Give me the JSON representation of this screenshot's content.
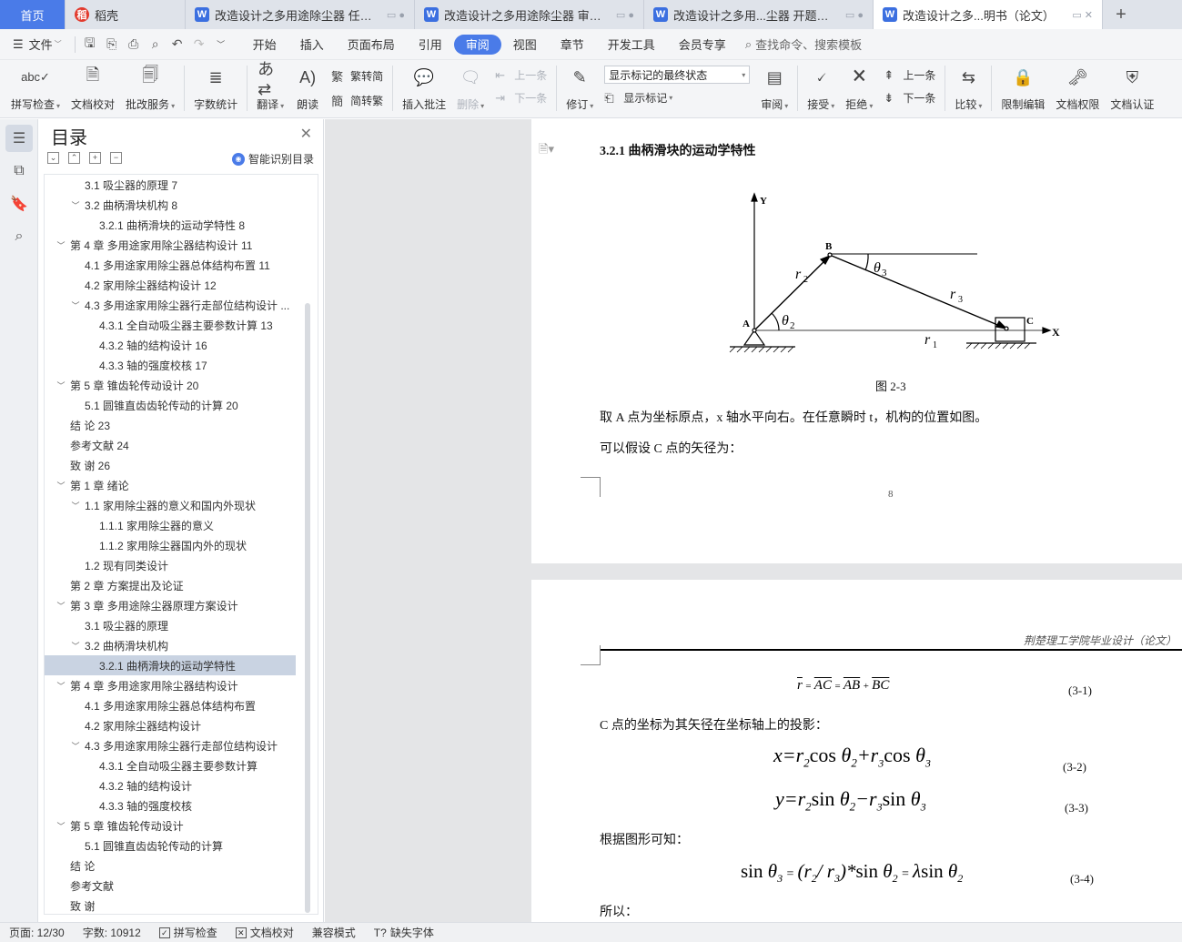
{
  "tabs": [
    {
      "label": "首页",
      "kind": "home"
    },
    {
      "label": "稻壳",
      "kind": "docer"
    },
    {
      "label": "改造设计之多用途除尘器 任务书",
      "kind": "doc"
    },
    {
      "label": "改造设计之多用途除尘器 审批表",
      "kind": "doc"
    },
    {
      "label": "改造设计之多用...尘器 开题报告",
      "kind": "doc"
    },
    {
      "label": "改造设计之多...明书（论文）",
      "kind": "doc",
      "active": true
    }
  ],
  "menubar": {
    "file_label": "文件",
    "tabs": [
      "开始",
      "插入",
      "页面布局",
      "引用",
      "审阅",
      "视图",
      "章节",
      "开发工具",
      "会员专享"
    ],
    "active_tab": "审阅",
    "search_placeholder": "查找命令、搜索模板"
  },
  "ribbon": {
    "spell_check": "拼写检查",
    "doc_proof": "文档校对",
    "review_service": "批改服务",
    "word_count": "字数统计",
    "translate": "翻译",
    "read_aloud": "朗读",
    "trad_to_simp": "繁转简",
    "simp_to_trad": "简转繁",
    "insert_comment": "插入批注",
    "delete": "删除",
    "prev_comment": "上一条",
    "next_comment": "下一条",
    "track_changes": "修订",
    "markup_state": "显示标记的最终状态",
    "show_markup": "显示标记",
    "review": "审阅",
    "accept": "接受",
    "reject": "拒绝",
    "prev_change": "上一条",
    "next_change": "下一条",
    "compare": "比较",
    "restrict_edit": "限制编辑",
    "doc_permission": "文档权限",
    "doc_cert": "文档认证"
  },
  "toc": {
    "title": "目录",
    "smart_label": "智能识别目录",
    "items": [
      {
        "text": "3.1 吸尘器的原理 7",
        "level": 2,
        "chevron": false
      },
      {
        "text": "3.2  曲柄滑块机构 8",
        "level": 2,
        "chevron": true
      },
      {
        "text": "3.2.1 曲柄滑块的运动学特性 8",
        "level": 3,
        "chevron": false
      },
      {
        "text": "第 4 章  多用途家用除尘器结构设计 11",
        "level": 1,
        "chevron": true
      },
      {
        "text": "4.1  多用途家用除尘器总体结构布置 11",
        "level": 2,
        "chevron": false
      },
      {
        "text": "4.2 家用除尘器结构设计 12",
        "level": 2,
        "chevron": false
      },
      {
        "text": "4.3 多用途家用除尘器行走部位结构设计  ...",
        "level": 2,
        "chevron": true
      },
      {
        "text": "4.3.1 全自动吸尘器主要参数计算 13",
        "level": 3,
        "chevron": false
      },
      {
        "text": "4.3.2 轴的结构设计 16",
        "level": 3,
        "chevron": false
      },
      {
        "text": "4.3.3 轴的强度校核 17",
        "level": 3,
        "chevron": false
      },
      {
        "text": "第 5 章  锥齿轮传动设计 20",
        "level": 1,
        "chevron": true
      },
      {
        "text": "5.1 圆锥直齿齿轮传动的计算 20",
        "level": 2,
        "chevron": false
      },
      {
        "text": "结    论 23",
        "level": 1,
        "chevron": false
      },
      {
        "text": "参考文献 24",
        "level": 1,
        "chevron": false
      },
      {
        "text": "致    谢 26",
        "level": 1,
        "chevron": false
      },
      {
        "text": "第 1 章  绪论",
        "level": 1,
        "chevron": true
      },
      {
        "text": "1.1 家用除尘器的意义和国内外现状",
        "level": 2,
        "chevron": true
      },
      {
        "text": "1.1.1 家用除尘器的意义",
        "level": 3,
        "chevron": false
      },
      {
        "text": "1.1.2 家用除尘器国内外的现状",
        "level": 3,
        "chevron": false
      },
      {
        "text": "1.2 现有同类设计",
        "level": 2,
        "chevron": false
      },
      {
        "text": "第 2 章  方案提出及论证",
        "level": 1,
        "chevron": false
      },
      {
        "text": "第 3 章  多用途除尘器原理方案设计",
        "level": 1,
        "chevron": true
      },
      {
        "text": "3.1 吸尘器的原理",
        "level": 2,
        "chevron": false
      },
      {
        "text": "3.2  曲柄滑块机构",
        "level": 2,
        "chevron": true
      },
      {
        "text": "3.2.1 曲柄滑块的运动学特性",
        "level": 3,
        "chevron": false,
        "selected": true
      },
      {
        "text": "第 4 章  多用途家用除尘器结构设计",
        "level": 1,
        "chevron": true
      },
      {
        "text": "4.1  多用途家用除尘器总体结构布置",
        "level": 2,
        "chevron": false
      },
      {
        "text": "4.2 家用除尘器结构设计",
        "level": 2,
        "chevron": false
      },
      {
        "text": "4.3 多用途家用除尘器行走部位结构设计",
        "level": 2,
        "chevron": true
      },
      {
        "text": "4.3.1 全自动吸尘器主要参数计算",
        "level": 3,
        "chevron": false
      },
      {
        "text": "4.3.2 轴的结构设计",
        "level": 3,
        "chevron": false
      },
      {
        "text": "4.3.3 轴的强度校核",
        "level": 3,
        "chevron": false
      },
      {
        "text": "第 5 章  锥齿轮传动设计",
        "level": 1,
        "chevron": true
      },
      {
        "text": "5.1 圆锥直齿齿轮传动的计算",
        "level": 2,
        "chevron": false
      },
      {
        "text": "结    论",
        "level": 1,
        "chevron": false
      },
      {
        "text": "参考文献",
        "level": 1,
        "chevron": false
      },
      {
        "text": "致    谢",
        "level": 1,
        "chevron": false
      }
    ]
  },
  "document": {
    "section_heading": "3.2.1 曲柄滑块的运动学特性",
    "figure_caption": "图 2-3",
    "para1": "取 A 点为坐标原点，x 轴水平向右。在任意瞬时 t，机构的位置如图。",
    "para2": "可以假设 C 点的矢径为：",
    "page_number": "8",
    "page_header": "荆楚理工学院毕业设计（论文）",
    "para3": "C 点的坐标为其矢径在坐标轴上的投影：",
    "para4": "根据图形可知：",
    "para5": "所以：",
    "figure": {
      "y_axis": "Y",
      "x_axis": "X",
      "point_a": "A",
      "point_b": "B",
      "point_c": "C",
      "r1": "r",
      "r1_sub": "1",
      "r2": "r",
      "r2_sub": "2",
      "r3": "r",
      "r3_sub": "3",
      "theta2": "θ",
      "theta2_sub": "2",
      "theta3": "θ",
      "theta3_sub": "3"
    },
    "equations": [
      {
        "text": "r = AC = AB + BC",
        "number": "(3-1)"
      },
      {
        "text": "x=r₂cos θ₂+r₃cos θ₃",
        "number": "(3-2)"
      },
      {
        "text": "y=r₂sin θ₂−r₃sin θ₃",
        "number": "(3-3)"
      },
      {
        "text": "sin θ₃ = (r₂/r₃)*sin θ₂ = λsin θ₂",
        "number": "(3-4)"
      }
    ]
  },
  "statusbar": {
    "page": "页面: 12/30",
    "words": "字数: 10912",
    "spell": "拼写检查",
    "proof": "文档校对",
    "compat": "兼容模式",
    "missing_font": "缺失字体"
  }
}
